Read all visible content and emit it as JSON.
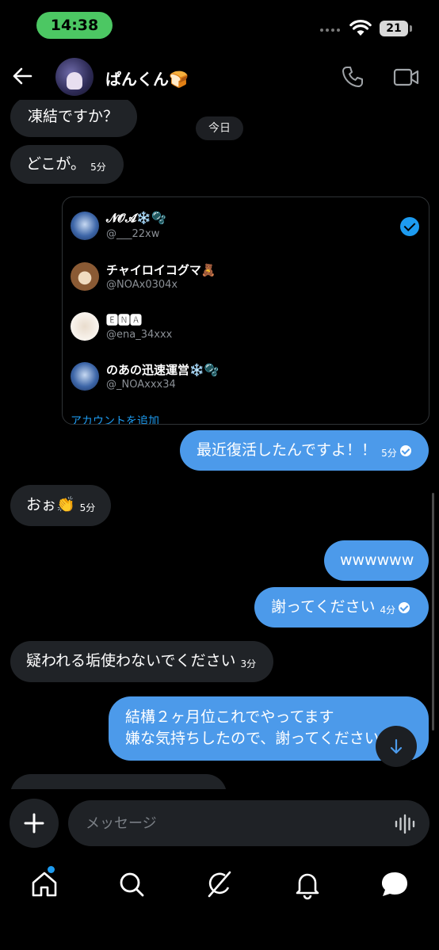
{
  "status_bar": {
    "time": "14:38",
    "battery": "21"
  },
  "header": {
    "contact_name": "ぱんくん🍞"
  },
  "chat": {
    "date_chip": "今日",
    "messages": [
      {
        "text": "凍結ですか？",
        "time": ""
      },
      {
        "text": "どこが。",
        "time": "5分"
      },
      {
        "text": "最近復活したんですよ！！",
        "time": "5分"
      },
      {
        "text": "おぉ👏",
        "time": "5分"
      },
      {
        "text": "wwwwww",
        "time": ""
      },
      {
        "text": "謝ってください",
        "time": "4分"
      },
      {
        "text": "疑われる垢使わないでください",
        "time": "3分"
      },
      {
        "line1": "結構２ヶ月位これでやってます",
        "line2": "嫌な気持ちしたので、謝ってください"
      }
    ]
  },
  "account_switcher": {
    "accounts": [
      {
        "name": "𝓝𝓞𝓐❄️🫧",
        "handle": "@___22xw",
        "selected": true
      },
      {
        "name": "チャイロイコグマ🧸",
        "handle": "@NOAx0304x",
        "selected": false
      },
      {
        "name": "🅴🅽🅰",
        "handle": "@ena_34xxx",
        "selected": false
      },
      {
        "name": "のあの迅速運営❄️🫧",
        "handle": "@_NOAxxx34",
        "selected": false
      }
    ],
    "add_account": "アカウントを追加"
  },
  "composer": {
    "placeholder": "メッセージ"
  },
  "colors": {
    "bubble_out": "#4c9aea",
    "bubble_in": "#202327",
    "accent": "#1d9bf0",
    "time_pill": "#4cc763"
  },
  "icons": [
    "back-arrow-icon",
    "phone-icon",
    "video-camera-icon",
    "plus-icon",
    "voice-wave-icon",
    "home-icon",
    "search-icon",
    "grok-icon",
    "bell-icon",
    "messages-icon",
    "arrow-down-icon",
    "wifi-icon",
    "checkmark-icon"
  ]
}
